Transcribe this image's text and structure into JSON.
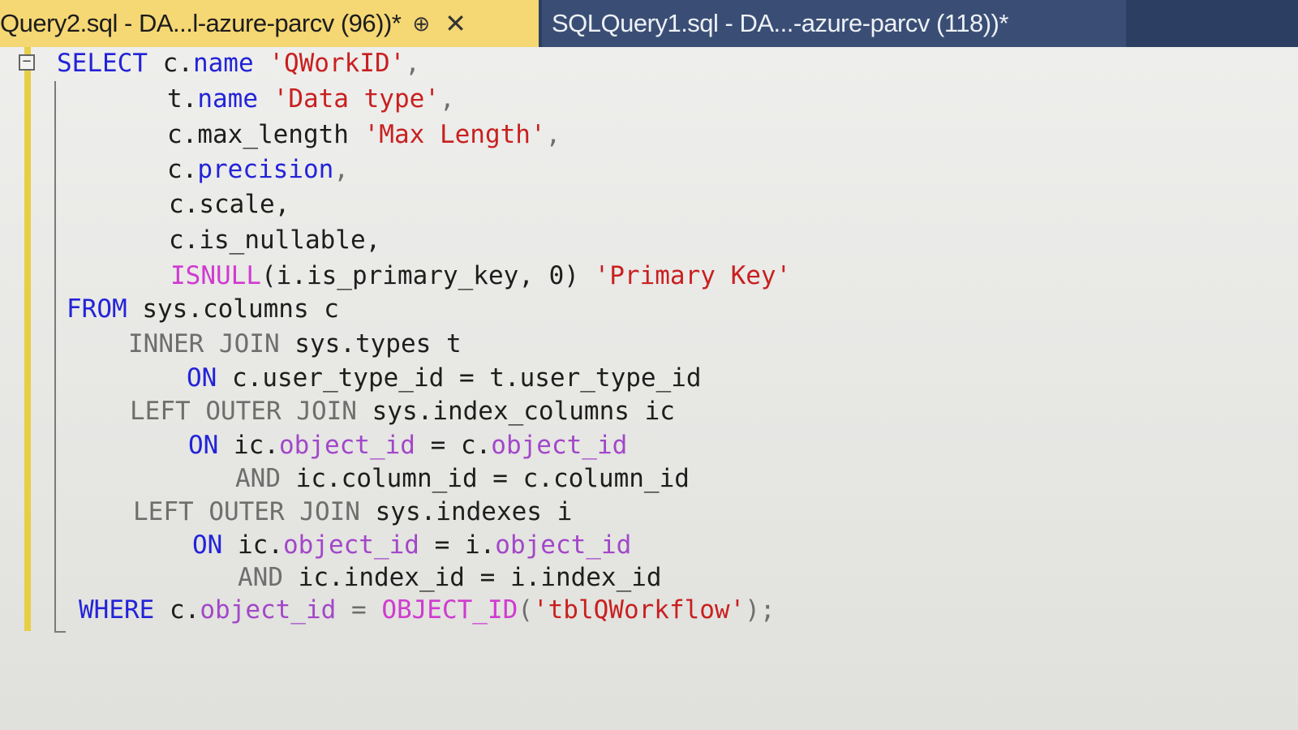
{
  "tabs": [
    {
      "title": "Query2.sql - DA...l-azure-parcv (96))*",
      "pin_glyph": "⊕",
      "close_glyph": "✕",
      "active": true
    },
    {
      "title": "SQLQuery1.sql - DA...-azure-parcv (118))*",
      "active": false
    }
  ],
  "editor": {
    "collapse_glyph": "−",
    "lines": [
      {
        "indent": "SELECT ",
        "parts": [
          "SELECT",
          "c.",
          "name",
          "'QWorkID'",
          ","
        ]
      },
      {
        "parts": [
          "t.",
          "name",
          "'Data type'",
          ","
        ]
      },
      {
        "parts": [
          "c.max_length",
          "'Max Length'",
          ","
        ]
      },
      {
        "parts": [
          "c.",
          "precision",
          ","
        ]
      },
      {
        "parts": [
          "c.scale,"
        ]
      },
      {
        "parts": [
          "c.is_nullable,"
        ]
      },
      {
        "parts": [
          "ISNULL",
          "(i.is_primary_key, 0)",
          "'Primary Key'"
        ]
      },
      {
        "parts": [
          "FROM",
          " sys.columns c"
        ]
      },
      {
        "parts": [
          "INNER JOIN",
          " sys.types t"
        ]
      },
      {
        "parts": [
          "ON",
          " c.user_type_id = t.user_type_id"
        ]
      },
      {
        "parts": [
          "LEFT OUTER JOIN",
          " sys.index_columns ic"
        ]
      },
      {
        "parts": [
          "ON",
          " ic.",
          "object_id",
          " = c.",
          "object_id"
        ]
      },
      {
        "parts": [
          "AND",
          " ic.column_id = c.column_id"
        ]
      },
      {
        "parts": [
          "LEFT OUTER JOIN",
          " sys.indexes i"
        ]
      },
      {
        "parts": [
          "ON",
          " ic.",
          "object_id",
          " = i.",
          "object_id"
        ]
      },
      {
        "parts": [
          "AND",
          " ic.index_id = i.index_id"
        ]
      },
      {
        "parts": [
          "WHERE",
          " c.",
          "object_id",
          " = ",
          "OBJECT_ID",
          "(",
          "'tblQWorkflow'",
          ");"
        ]
      }
    ]
  },
  "colors": {
    "active_tab": "#f5d774",
    "tab_bar": "#2d3e63",
    "keyword": "#2323d8",
    "string": "#c82020",
    "function": "#d03ad0",
    "gray_keyword": "#6e6e6e",
    "change_bar": "#e7cf45"
  }
}
